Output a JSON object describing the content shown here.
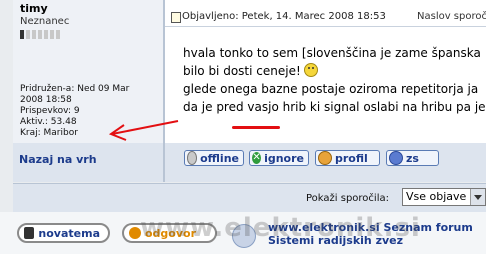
{
  "post": {
    "author": {
      "username": "timy",
      "rank": "Neznanec",
      "rank_level": 1,
      "stats": [
        "Pridružen-a: Ned 09 Mar",
        "2008 18:58",
        "Prispevkov: 9",
        "Aktiv.: 53.48",
        "Kraj: Maribor"
      ]
    },
    "to_top_label": "Nazaj na vrh",
    "meta": {
      "published": "Objavljeno: Petek, 14. Marec 2008 18:53",
      "subject": "Naslov sporočila"
    },
    "body_lines": [
      "hvala tonko to sem [slovenščina je zame španska",
      "bilo bi dosti ceneje!",
      "glede onega bazne postaje oziroma repetitorja ja",
      "da je pred vasjo hrib ki signal oslabi na hribu pa je"
    ],
    "buttons": {
      "offline": "offline",
      "ignore": "ignore",
      "profil": "profil",
      "zs": "zs"
    }
  },
  "filter": {
    "label": "Pokaži sporočila:",
    "selected": "Vse objave"
  },
  "footer": {
    "nova_label": "novatema",
    "reply_label": "odgovor",
    "link_line1": "www.elektronik.si Seznam forum",
    "link_line2": "Sistemi radijskih zvez",
    "watermark": "www.elektronik.si"
  },
  "colors": {
    "annotation_red": "#e30f12",
    "link_blue": "#1c3b8c"
  }
}
